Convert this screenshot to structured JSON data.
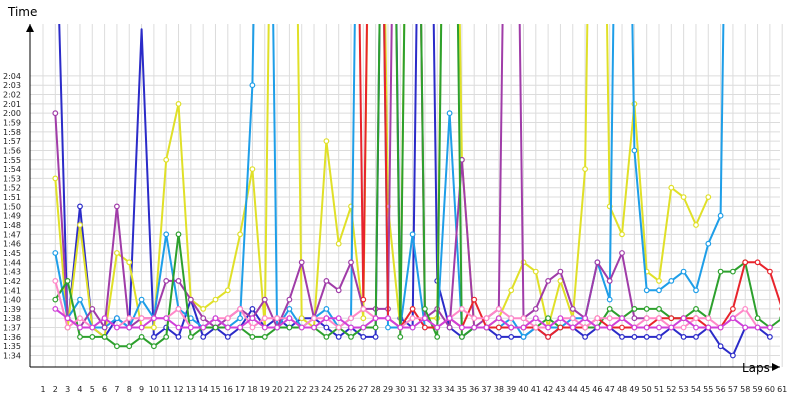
{
  "chart_data": {
    "type": "line",
    "title": "",
    "xlabel": "Laps",
    "ylabel": "Time",
    "x_ticks": [
      "1",
      "2",
      "3",
      "4",
      "5",
      "6",
      "7",
      "8",
      "9",
      "10",
      "11",
      "12",
      "13",
      "14",
      "15",
      "16",
      "17",
      "18",
      "19",
      "20",
      "21",
      "22",
      "23",
      "24",
      "25",
      "26",
      "27",
      "28",
      "29",
      "30",
      "31",
      "32",
      "33",
      "34",
      "35",
      "36",
      "37",
      "38",
      "39",
      "40",
      "41",
      "42",
      "43",
      "44",
      "45",
      "46",
      "47",
      "48",
      "49",
      "50",
      "51",
      "52",
      "53",
      "54",
      "55",
      "56",
      "57",
      "58",
      "59",
      "60",
      "61"
    ],
    "y_ticks": [
      "1:34",
      "1:35",
      "1:36",
      "1:37",
      "1:38",
      "1:39",
      "1:40",
      "1:41",
      "1:42",
      "1:43",
      "1:44",
      "1:45",
      "1:46",
      "1:47",
      "1:48",
      "1:49",
      "1:50",
      "1:51",
      "1:52",
      "1:53",
      "1:54",
      "1:55",
      "1:56",
      "1:57",
      "1:58",
      "1:59",
      "2:00",
      "2:01",
      "2:02",
      "2:03",
      "2:04"
    ],
    "ylim": [
      93,
      126
    ],
    "xlim": [
      0.5,
      61.5
    ],
    "grid": true,
    "legend": "none",
    "series": [
      {
        "color": "#2b2bc8",
        "values": [
          null,
          145,
          97,
          110,
          97,
          96,
          98,
          97,
          129,
          96,
          97,
          96,
          100,
          96,
          97,
          96,
          97,
          99,
          97,
          98,
          97,
          98,
          98,
          97,
          96,
          97,
          96,
          96,
          200,
          98,
          97,
          200,
          102,
          97,
          96,
          97,
          97,
          96,
          96,
          96,
          97,
          96,
          97,
          97,
          96,
          97,
          97,
          96,
          96,
          96,
          96,
          97,
          96,
          96,
          97,
          95,
          94,
          97,
          97,
          96,
          null
        ]
      },
      {
        "color": "#e0e028",
        "values": [
          null,
          113,
          97,
          108,
          97,
          96,
          105,
          104,
          97,
          97,
          115,
          121,
          100,
          99,
          100,
          101,
          107,
          114,
          97,
          200,
          200,
          98,
          97,
          117,
          106,
          110,
          98,
          200,
          110,
          97,
          200,
          98,
          98,
          200,
          115,
          97,
          97,
          98,
          101,
          104,
          103,
          97,
          102,
          98,
          114,
          200,
          110,
          107,
          121,
          103,
          102,
          112,
          111,
          108,
          111,
          null,
          null,
          null,
          null,
          null,
          null
        ]
      },
      {
        "color": "#1e9ee8",
        "values": [
          null,
          105,
          98,
          100,
          97,
          97,
          98,
          97,
          100,
          98,
          107,
          99,
          98,
          97,
          98,
          97,
          98,
          123,
          200,
          97,
          99,
          97,
          98,
          99,
          97,
          98,
          200,
          200,
          97,
          97,
          107,
          97,
          97,
          120,
          97,
          97,
          97,
          97,
          98,
          96,
          97,
          97,
          97,
          98,
          98,
          104,
          100,
          200,
          116,
          101,
          101,
          102,
          103,
          101,
          106,
          109,
          200,
          null,
          null,
          null,
          null
        ]
      },
      {
        "color": "#a03ca8",
        "values": [
          null,
          120,
          98,
          97,
          99,
          97,
          110,
          97,
          98,
          98,
          102,
          102,
          100,
          98,
          97,
          98,
          99,
          98,
          100,
          97,
          100,
          104,
          98,
          102,
          101,
          104,
          99,
          99,
          99,
          200,
          200,
          98,
          99,
          97,
          115,
          97,
          98,
          99,
          200,
          98,
          99,
          102,
          103,
          99,
          98,
          104,
          102,
          105,
          98,
          98,
          null,
          null,
          null,
          null,
          null,
          null,
          null,
          null,
          null,
          null,
          null
        ]
      },
      {
        "color": "#2da02d",
        "values": [
          null,
          100,
          102,
          96,
          96,
          96,
          95,
          95,
          96,
          95,
          96,
          107,
          96,
          97,
          97,
          97,
          97,
          96,
          96,
          97,
          97,
          97,
          97,
          96,
          97,
          96,
          97,
          97,
          200,
          96,
          200,
          99,
          96,
          200,
          96,
          97,
          97,
          97,
          97,
          97,
          97,
          98,
          97,
          97,
          97,
          97,
          99,
          98,
          99,
          99,
          99,
          98,
          98,
          99,
          98,
          103,
          103,
          104,
          98,
          97,
          98
        ]
      },
      {
        "color": "#e8242c",
        "values": [
          null,
          null,
          null,
          null,
          null,
          null,
          null,
          null,
          null,
          null,
          null,
          null,
          null,
          null,
          null,
          null,
          null,
          null,
          null,
          null,
          null,
          null,
          null,
          null,
          null,
          200,
          100,
          200,
          98,
          97,
          99,
          97,
          97,
          98,
          97,
          100,
          97,
          97,
          97,
          97,
          97,
          96,
          97,
          97,
          97,
          98,
          97,
          97,
          97,
          97,
          98,
          98,
          98,
          98,
          97,
          97,
          99,
          104,
          104,
          103,
          99
        ]
      },
      {
        "color": "#ff88c8",
        "values": [
          null,
          102,
          97,
          98,
          97,
          98,
          97,
          98,
          98,
          98,
          98,
          99,
          97,
          97,
          98,
          98,
          99,
          97,
          98,
          98,
          98,
          97,
          98,
          98,
          97,
          98,
          99,
          98,
          98,
          97,
          98,
          98,
          97,
          98,
          99,
          98,
          98,
          99,
          98,
          98,
          97,
          97,
          98,
          98,
          97,
          98,
          98,
          98,
          97,
          98,
          98,
          97,
          97,
          98,
          98,
          97,
          98,
          99,
          97,
          97,
          null
        ]
      },
      {
        "color": "#d040d8",
        "values": [
          null,
          99,
          98,
          97,
          97,
          98,
          97,
          97,
          97,
          98,
          98,
          97,
          97,
          97,
          98,
          97,
          97,
          98,
          97,
          97,
          98,
          97,
          97,
          98,
          98,
          97,
          97,
          98,
          98,
          97,
          97,
          98,
          97,
          98,
          97,
          97,
          97,
          98,
          97,
          97,
          98,
          97,
          98,
          97,
          98,
          97,
          97,
          98,
          97,
          97,
          97,
          97,
          98,
          97,
          97,
          97,
          98,
          97,
          97,
          97,
          null
        ]
      }
    ]
  }
}
